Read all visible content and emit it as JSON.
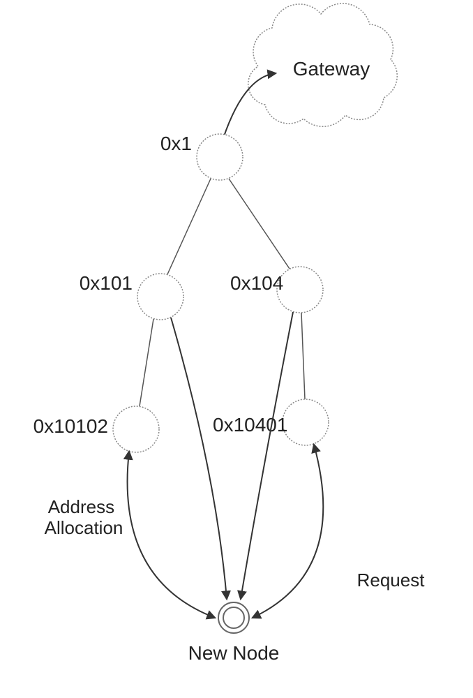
{
  "gateway_label": "Gateway",
  "nodes": {
    "root": "0x1",
    "left1": "0x101",
    "right1": "0x104",
    "left2": "0x10102",
    "right2": "0x10401"
  },
  "new_node_label": "New Node",
  "edge_labels": {
    "left": "Address\nAllocation",
    "right": "Request"
  }
}
